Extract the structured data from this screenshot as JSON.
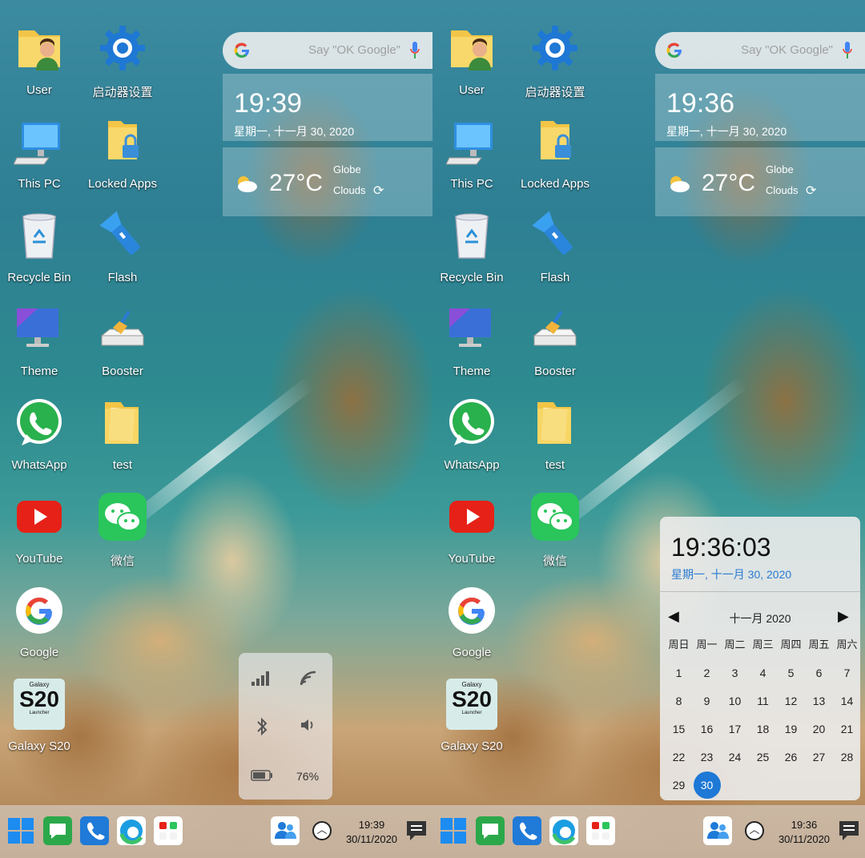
{
  "desktop_apps": [
    "User",
    "启动器设置",
    "This PC",
    "Locked Apps",
    "Recycle Bin",
    "Flash",
    "Theme",
    "Booster",
    "WhatsApp",
    "test",
    "YouTube",
    "微信",
    "Google",
    "Galaxy S20"
  ],
  "galaxy_badge": {
    "top": "Galaxy",
    "main": "S20",
    "bottom": "Launcher"
  },
  "search": {
    "placeholder": "Say \"OK Google\""
  },
  "left": {
    "clock_time": "19:39",
    "clock_date": "星期一, 十一月 30, 2020",
    "weather": {
      "temp": "27°C",
      "location": "Globe",
      "condition": "Clouds"
    },
    "quick_settings": {
      "battery": "76%"
    },
    "taskbar": {
      "time": "19:39",
      "date": "30/11/2020"
    }
  },
  "right": {
    "clock_time": "19:36",
    "clock_date": "星期一, 十一月 30, 2020",
    "weather": {
      "temp": "27°C",
      "location": "Globe",
      "condition": "Clouds"
    },
    "taskbar": {
      "time": "19:36",
      "date": "30/11/2020"
    },
    "calendar": {
      "time": "19:36:03",
      "date": "星期一, 十一月 30, 2020",
      "month": "十一月 2020",
      "weekdays": [
        "周日",
        "周一",
        "周二",
        "周三",
        "周四",
        "周五",
        "周六"
      ],
      "days": [
        "1",
        "2",
        "3",
        "4",
        "5",
        "6",
        "7",
        "8",
        "9",
        "10",
        "11",
        "12",
        "13",
        "14",
        "15",
        "16",
        "17",
        "18",
        "19",
        "20",
        "21",
        "22",
        "23",
        "24",
        "25",
        "26",
        "27",
        "28",
        "29",
        "30"
      ],
      "selected": "30"
    }
  },
  "colors": {
    "accent": "#1d78d6",
    "calendar_date": "#2a7ad2"
  }
}
